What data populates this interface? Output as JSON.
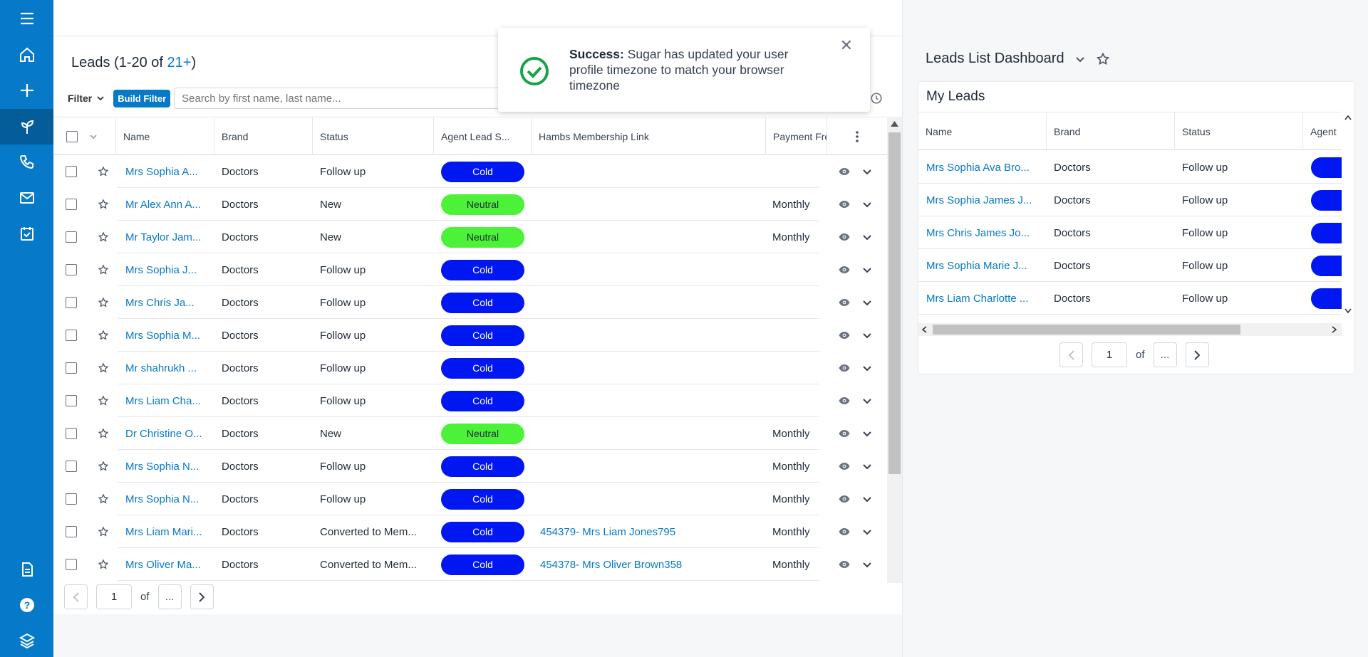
{
  "colors": {
    "brand": "#0679c8",
    "cold": "#0017f2",
    "neutral": "#4cf238",
    "success": "#16a34a"
  },
  "nav": {
    "items": [
      {
        "name": "menu-icon"
      },
      {
        "name": "home-icon"
      },
      {
        "name": "plus-icon"
      },
      {
        "name": "leads-icon"
      },
      {
        "name": "phone-icon"
      },
      {
        "name": "mail-icon"
      },
      {
        "name": "calendar-check-icon"
      }
    ],
    "bottom": [
      {
        "name": "document-icon"
      },
      {
        "name": "help-icon"
      },
      {
        "name": "layers-icon"
      }
    ]
  },
  "list": {
    "title_prefix": "Leads (1-20 of ",
    "title_count": "21+",
    "title_suffix": ")",
    "filter_label": "Filter",
    "build_filter_label": "Build Filter",
    "search_placeholder": "Search by first name, last name...",
    "columns": [
      "Name",
      "Brand",
      "Status",
      "Agent Lead S...",
      "Hambs Membership Link",
      "Payment Fre"
    ],
    "rows": [
      {
        "name": "Mrs Sophia A...",
        "brand": "Doctors",
        "status": "Follow up",
        "agent": "Cold",
        "link": "",
        "payment": ""
      },
      {
        "name": "Mr Alex Ann A...",
        "brand": "Doctors",
        "status": "New",
        "agent": "Neutral",
        "link": "",
        "payment": "Monthly"
      },
      {
        "name": "Mr Taylor Jam...",
        "brand": "Doctors",
        "status": "New",
        "agent": "Neutral",
        "link": "",
        "payment": "Monthly"
      },
      {
        "name": "Mrs Sophia J...",
        "brand": "Doctors",
        "status": "Follow up",
        "agent": "Cold",
        "link": "",
        "payment": ""
      },
      {
        "name": "Mrs Chris Ja...",
        "brand": "Doctors",
        "status": "Follow up",
        "agent": "Cold",
        "link": "",
        "payment": ""
      },
      {
        "name": "Mrs Sophia M...",
        "brand": "Doctors",
        "status": "Follow up",
        "agent": "Cold",
        "link": "",
        "payment": ""
      },
      {
        "name": "Mr shahrukh ...",
        "brand": "Doctors",
        "status": "Follow up",
        "agent": "Cold",
        "link": "",
        "payment": ""
      },
      {
        "name": "Mrs Liam Cha...",
        "brand": "Doctors",
        "status": "Follow up",
        "agent": "Cold",
        "link": "",
        "payment": ""
      },
      {
        "name": "Dr Christine O...",
        "brand": "Doctors",
        "status": "New",
        "agent": "Neutral",
        "link": "",
        "payment": "Monthly"
      },
      {
        "name": "Mrs Sophia N...",
        "brand": "Doctors",
        "status": "Follow up",
        "agent": "Cold",
        "link": "",
        "payment": "Monthly"
      },
      {
        "name": "Mrs Sophia N...",
        "brand": "Doctors",
        "status": "Follow up",
        "agent": "Cold",
        "link": "",
        "payment": "Monthly"
      },
      {
        "name": "Mrs Liam Mari...",
        "brand": "Doctors",
        "status": "Converted to Mem...",
        "agent": "Cold",
        "link": "454379- Mrs Liam Jones795",
        "payment": "Monthly"
      },
      {
        "name": "Mrs Oliver Ma...",
        "brand": "Doctors",
        "status": "Converted to Mem...",
        "agent": "Cold",
        "link": "454378- Mrs Oliver Brown358",
        "payment": "Monthly"
      }
    ],
    "pager": {
      "page": "1",
      "of": "of",
      "total": "..."
    }
  },
  "dashboard": {
    "title": "Leads List Dashboard",
    "dashlet_title": "My Leads",
    "columns": [
      "Name",
      "Brand",
      "Status",
      "Agent"
    ],
    "rows": [
      {
        "name": "Mrs Sophia Ava Bro...",
        "brand": "Doctors",
        "status": "Follow up"
      },
      {
        "name": "Mrs Sophia James J...",
        "brand": "Doctors",
        "status": "Follow up"
      },
      {
        "name": "Mrs Chris James Jo...",
        "brand": "Doctors",
        "status": "Follow up"
      },
      {
        "name": "Mrs Sophia Marie J...",
        "brand": "Doctors",
        "status": "Follow up"
      },
      {
        "name": "Mrs Liam Charlotte ...",
        "brand": "Doctors",
        "status": "Follow up"
      }
    ],
    "pager": {
      "page": "1",
      "of": "of",
      "total": "..."
    }
  },
  "toast": {
    "title": "Success:",
    "message": " Sugar has updated your user profile timezone to match your browser timezone"
  }
}
